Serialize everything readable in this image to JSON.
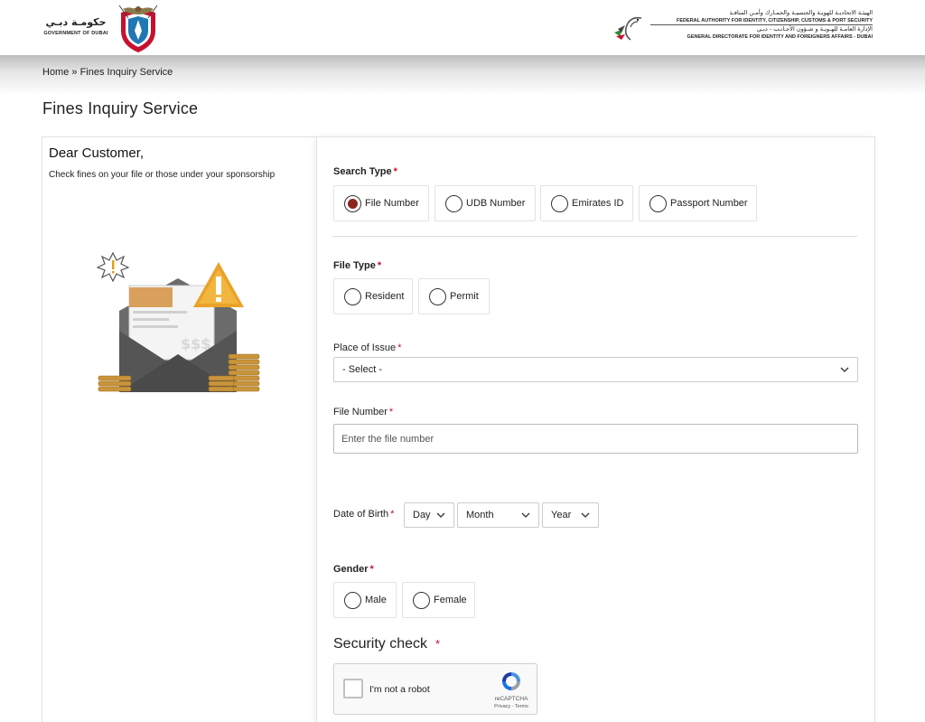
{
  "header": {
    "gov_logo": {
      "arabic": "حكومـة دبـي",
      "english": "GOVERNMENT OF DUBAI"
    },
    "gdrfa_logo": {
      "arabic_line1": "الهيئـة الاتحاديـة للهويـة والجنسيـة والجمـارك وأمـن المنافـذ",
      "english_line1": "FEDERAL AUTHORITY FOR IDENTITY, CITIZENSHIP, CUSTOMS & PORT SECURITY",
      "arabic_line2": "الإدارة العامـة للهـويـة و شـؤون الأجـانـب - دبـي",
      "english_line2": "GENERAL DIRECTORATE FOR IDENTITY AND FOREIGNERS AFFAIRS - DUBAI"
    }
  },
  "breadcrumb": {
    "home": "Home",
    "separator": " » ",
    "current": "Fines Inquiry Service"
  },
  "page_title": "Fines Inquiry Service",
  "intro": {
    "greeting": "Dear Customer,",
    "subtitle": "Check fines on your file or those under your sponsorship",
    "illustration_text": "$$$"
  },
  "form": {
    "required_marker": "*",
    "search_type": {
      "label": "Search Type",
      "options": [
        "File Number",
        "UDB Number",
        "Emirates ID",
        "Passport Number"
      ],
      "selected": "File Number"
    },
    "file_type": {
      "label": "File Type",
      "options": [
        "Resident",
        "Permit"
      ]
    },
    "place_of_issue": {
      "label": "Place of Issue",
      "value": "- Select -"
    },
    "file_number": {
      "label": "File Number",
      "placeholder": "Enter the file number"
    },
    "date_of_birth": {
      "label": "Date of Birth",
      "day": "Day",
      "month": "Month",
      "year": "Year"
    },
    "gender": {
      "label": "Gender",
      "options": [
        "Male",
        "Female"
      ]
    },
    "security": {
      "title": "Security check",
      "checkbox_label": "I'm not a robot",
      "brand": "reCAPTCHA",
      "terms": "Privacy - Terms"
    }
  },
  "colors": {
    "selected_radio": "#8b2520",
    "required": "#c8102e",
    "emblem_red": "#c8102e",
    "emblem_blue": "#1f77b4"
  }
}
